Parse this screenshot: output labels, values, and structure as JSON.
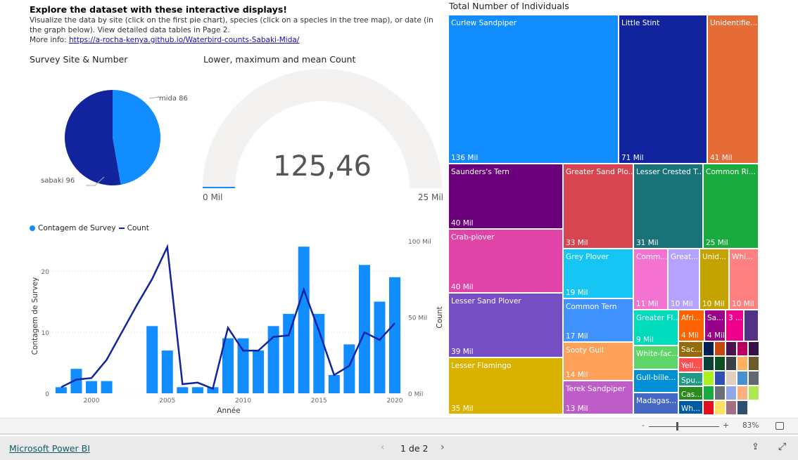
{
  "header": {
    "title": "Explore the dataset with these interactive displays!",
    "description": "Visualize the data by site (click on the first pie chart), species (click on a species in the tree map), or date (in the graph below). View detailed data tables in Page 2.",
    "more_info_label": "More info: ",
    "more_info_link": "https://a-rocha-kenya.github.io/Waterbird-counts-Sabaki-Mida/"
  },
  "pie": {
    "title": "Survey Site & Number",
    "chart_data": {
      "type": "pie",
      "slices": [
        {
          "label": "mida 86",
          "name": "mida",
          "value": 86,
          "color": "#118DFF"
        },
        {
          "label": "sabaki 96",
          "name": "sabaki",
          "value": 96,
          "color": "#12239E"
        }
      ]
    }
  },
  "gauge": {
    "title": "Lower, maximum and mean Count",
    "value_label": "125,46",
    "value": 125.46,
    "min_label": "0 Mil",
    "max_label": "25 Mil",
    "min": 0,
    "max": 25000000,
    "fill_color": "#118DFF",
    "track_color": "#F3F2F1"
  },
  "combo": {
    "legend": [
      {
        "label": "Contagem de Survey",
        "color": "#118DFF"
      },
      {
        "label": "Count",
        "color": "#12239E"
      }
    ],
    "chart_data": {
      "type": "bar",
      "xlabel": "Année",
      "ylabel": "Contagem de Survey",
      "y2label": "Count",
      "x": [
        1998,
        1999,
        2000,
        2001,
        2002,
        2003,
        2004,
        2005,
        2006,
        2007,
        2008,
        2009,
        2010,
        2011,
        2012,
        2013,
        2014,
        2015,
        2016,
        2017,
        2018,
        2019,
        2020
      ],
      "xticks": [
        "2000",
        "2005",
        "2010",
        "2015",
        "2020"
      ],
      "yticks": [
        "0",
        "10",
        "20"
      ],
      "y2ticks": [
        "0 Mil",
        "50 Mil",
        "100 Mil"
      ],
      "ylim": [
        0,
        25
      ],
      "y2lim": [
        0,
        100
      ],
      "series": [
        {
          "name": "Contagem de Survey",
          "type": "bar",
          "axis": "left",
          "values": [
            1,
            4,
            2,
            2,
            0,
            0,
            11,
            7,
            1,
            1,
            1,
            9,
            9,
            7,
            11,
            13,
            24,
            13,
            3,
            8,
            21,
            15,
            19
          ]
        },
        {
          "name": "Count",
          "type": "line",
          "axis": "right",
          "unit": "Mil",
          "values": [
            4,
            9,
            10,
            22,
            40,
            58,
            75,
            96,
            6,
            7,
            3,
            43,
            28,
            28,
            37,
            38,
            68,
            41,
            12,
            18,
            40,
            35,
            46
          ]
        }
      ]
    }
  },
  "treemap": {
    "title": "Total Number of Individuals",
    "tiles": [
      {
        "name": "Curlew Sandpiper",
        "value": "136 Mil",
        "color": "#118DFF"
      },
      {
        "name": "Little Stint",
        "value": "71 Mil",
        "color": "#12239E"
      },
      {
        "name": "Unidentifie...",
        "value": "41 Mil",
        "color": "#E66C37"
      },
      {
        "name": "Saunders's Tern",
        "value": "40 Mil",
        "color": "#6B007B"
      },
      {
        "name": "Greater Sand Plo...",
        "value": "33 Mil",
        "color": "#D64550"
      },
      {
        "name": "Lesser Crested T...",
        "value": "31 Mil",
        "color": "#197278"
      },
      {
        "name": "Common Ri...",
        "value": "25 Mil",
        "color": "#1AAB40"
      },
      {
        "name": "Crab-plover",
        "value": "40 Mil",
        "color": "#E044A7"
      },
      {
        "name": "Lesser Sand Plover",
        "value": "39 Mil",
        "color": "#744EC2"
      },
      {
        "name": "Lesser Flamingo",
        "value": "35 Mil",
        "color": "#D9B300"
      },
      {
        "name": "Grey Plover",
        "value": "19 Mil",
        "color": "#15C6F4"
      },
      {
        "name": "Common Tern",
        "value": "17 Mil",
        "color": "#4092FF"
      },
      {
        "name": "Sooty Gull",
        "value": "14 Mil",
        "color": "#FFA058"
      },
      {
        "name": "Terek Sandpiper",
        "value": "13 Mil",
        "color": "#BE5DC9"
      },
      {
        "name": "Comm...",
        "value": "11 Mil",
        "color": "#F472D0"
      },
      {
        "name": "Great...",
        "value": "10 Mil",
        "color": "#B5A1FF"
      },
      {
        "name": "Unid...",
        "value": "10 Mil",
        "color": "#C4A200"
      },
      {
        "name": "Whi...",
        "value": "10 Mil",
        "color": "#FF8080"
      },
      {
        "name": "Greater Fl...",
        "value": "9 Mil",
        "color": "#00DBBC"
      },
      {
        "name": "Afri...",
        "value": "4 Mil",
        "color": "#FF6300"
      },
      {
        "name": "Sa...",
        "value": "4 Mil",
        "color": "#99008A"
      },
      {
        "name": "3 ...",
        "value": "",
        "color": "#EC008C"
      },
      {
        "name": "",
        "value": "",
        "color": "#533285"
      },
      {
        "name": "White-fac...",
        "value": "",
        "color": "#5DD667"
      },
      {
        "name": "Gull-bille...",
        "value": "",
        "color": "#0090D6"
      },
      {
        "name": "Madagas...",
        "value": "",
        "color": "#4668C5"
      },
      {
        "name": "Sac...",
        "value": "",
        "color": "#946B0B"
      },
      {
        "name": "Yell...",
        "value": "",
        "color": "#FF4F4F"
      },
      {
        "name": "Spu...",
        "value": "",
        "color": "#1F9A85"
      },
      {
        "name": "Cas...",
        "value": "",
        "color": "#2B8A1E"
      },
      {
        "name": "Wh...",
        "value": "",
        "color": "#005BA3"
      }
    ],
    "small_colors": [
      "#002050",
      "#C44B10",
      "#4A1350",
      "#B80060",
      "#36124A",
      "#0A4038",
      "#0B5020",
      "#3A3F48",
      "#FFB060",
      "#6B5A2A",
      "#A8F020",
      "#3050B0",
      "#E0D0C0",
      "#4890D0",
      "#606870",
      "#1AAB40",
      "#6A7078",
      "#90A8E8",
      "#FFB080",
      "#B0E850",
      "#E01020",
      "#FFE060",
      "#A07080",
      "#305070"
    ]
  },
  "zoom": {
    "minus": "-",
    "plus": "+",
    "percent": "83%",
    "level": 83
  },
  "footer": {
    "brand": "Microsoft Power BI",
    "page_label": "1 de 2"
  }
}
